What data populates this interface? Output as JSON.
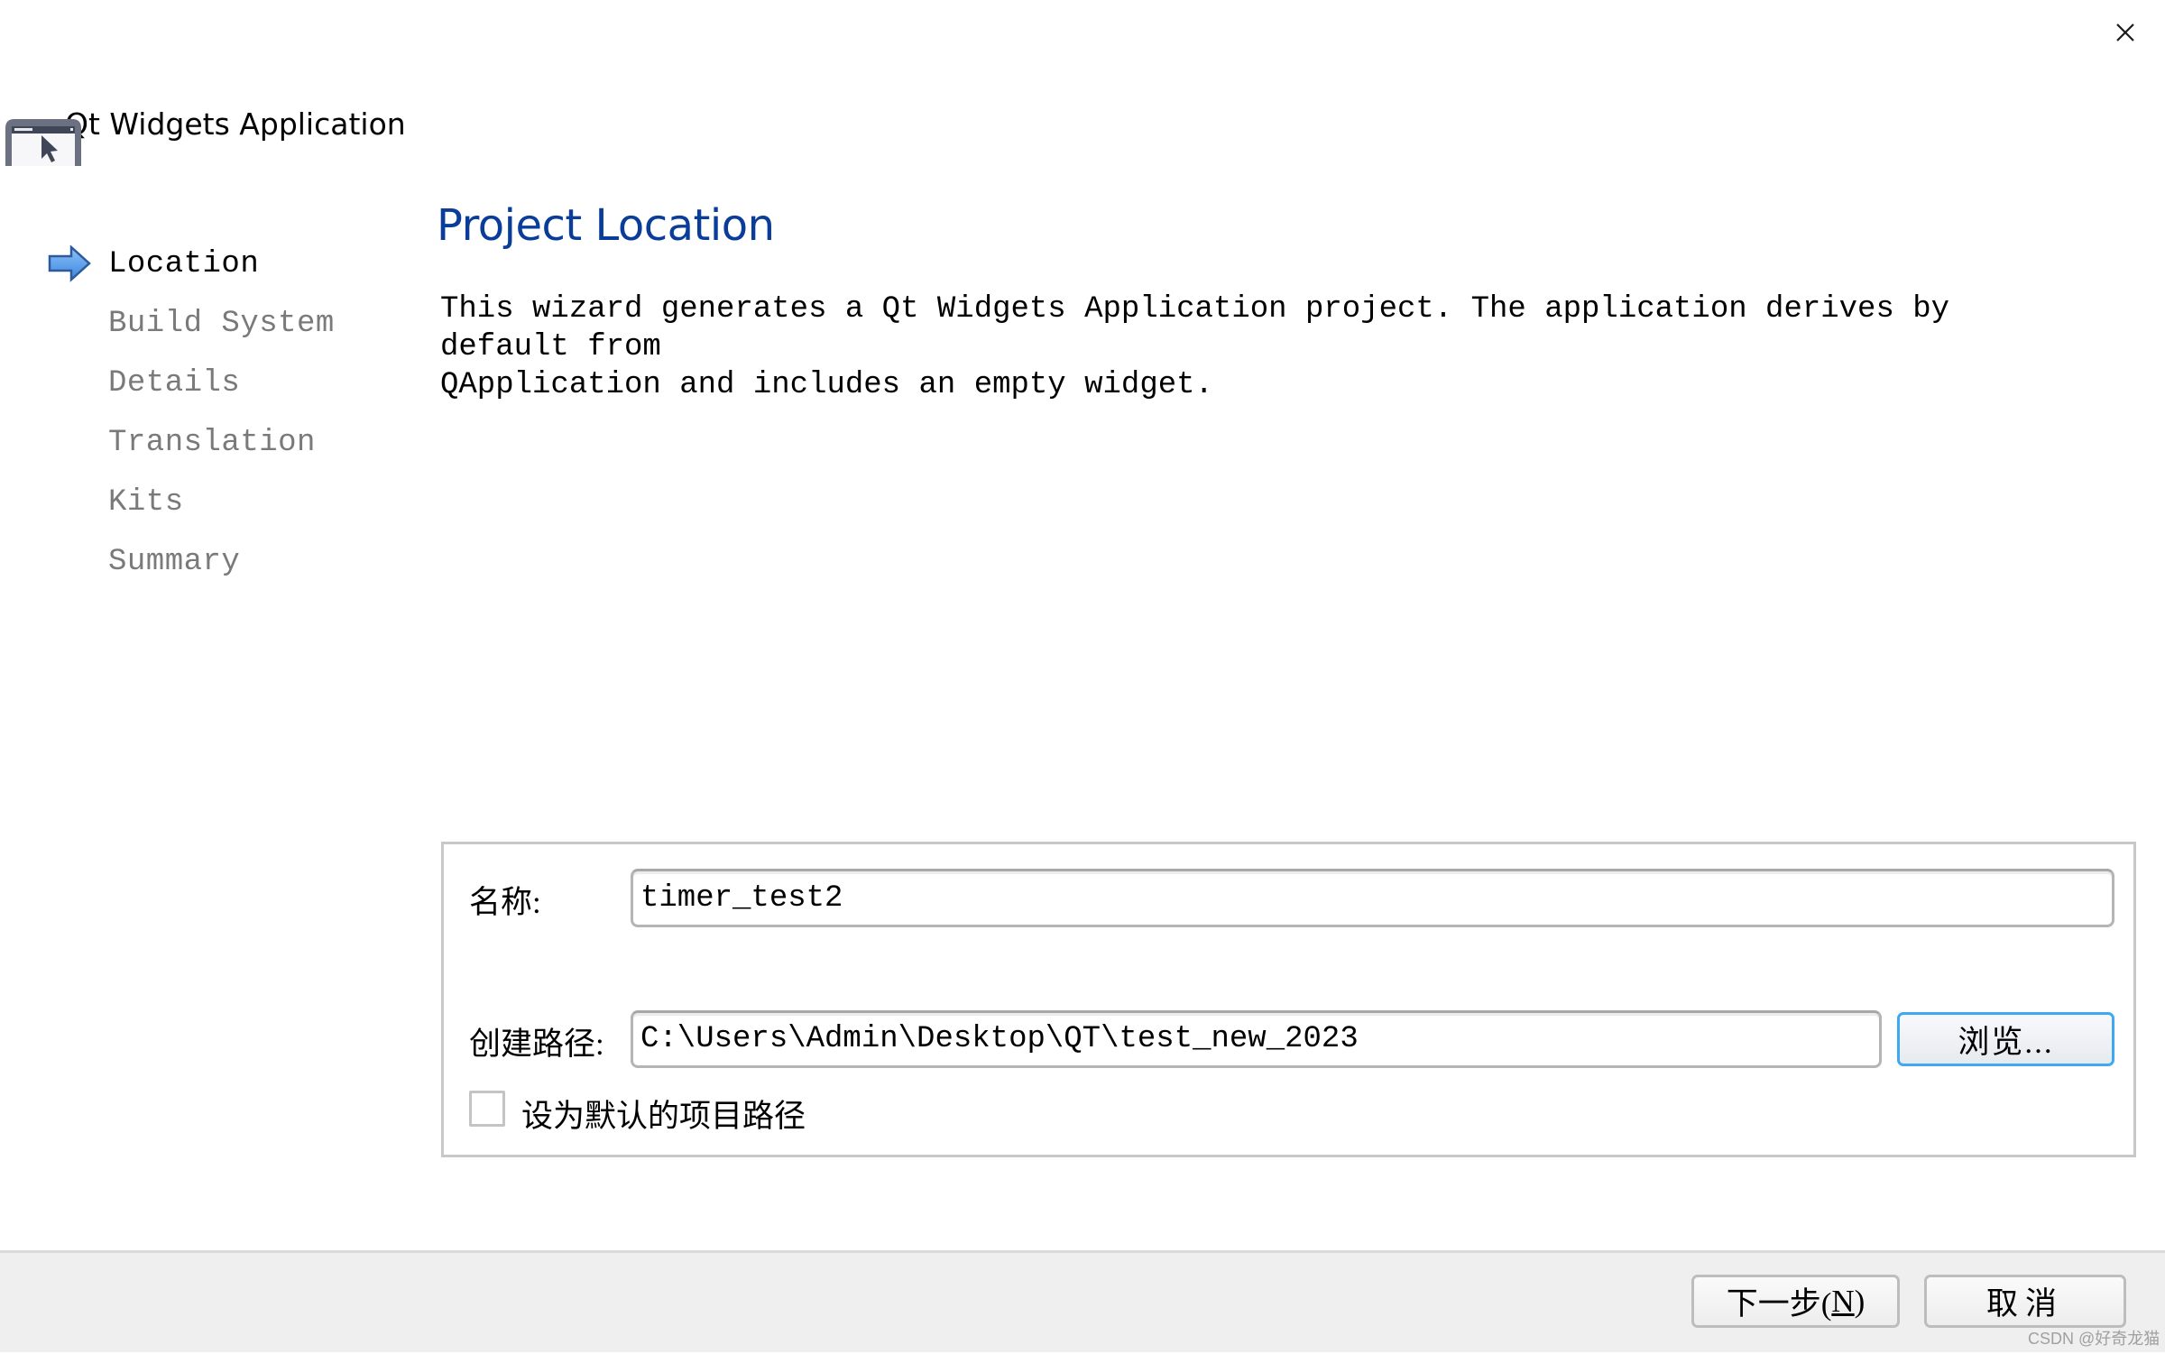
{
  "window": {
    "title": "Qt Widgets Application",
    "close_icon": "close-icon",
    "app_icon": "window-cursor-icon"
  },
  "steps": {
    "current_marker_icon": "arrow-right-icon",
    "items": [
      {
        "label": "Location",
        "current": true
      },
      {
        "label": "Build System",
        "current": false
      },
      {
        "label": "Details",
        "current": false
      },
      {
        "label": "Translation",
        "current": false
      },
      {
        "label": "Kits",
        "current": false
      },
      {
        "label": "Summary",
        "current": false
      }
    ]
  },
  "page": {
    "title": "Project Location",
    "title_color": "#0a3d9a",
    "description": "This wizard generates a Qt Widgets Application project. The application derives by default from\nQApplication and includes an empty widget."
  },
  "form": {
    "name_label": "名称:",
    "name_value": "timer_test2",
    "path_label": "创建路径:",
    "path_value": "C:\\Users\\Admin\\Desktop\\QT\\test_new_2023",
    "browse_label": "浏览...",
    "browse_focus_color": "#3ea8f0",
    "default_path_checkbox_label": "设为默认的项目路径",
    "default_path_checked": false
  },
  "footer": {
    "next_label_prefix": "下一步(",
    "next_mnemonic": "N",
    "next_label_suffix": ")",
    "cancel_label": "取消"
  },
  "watermark": "CSDN @好奇龙猫"
}
